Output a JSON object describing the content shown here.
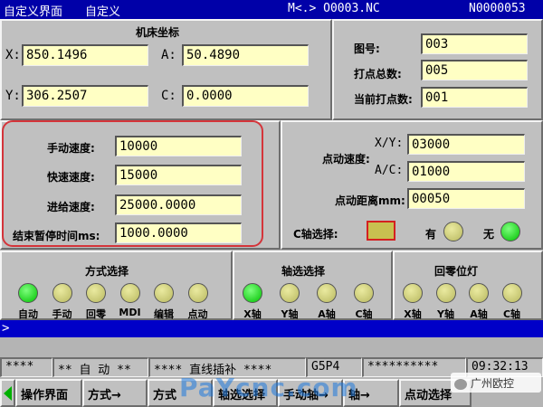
{
  "title_bar": {
    "screen_name": "自定义界面",
    "mode": "自定义",
    "program": "M<.> O0003.NC",
    "block": "N0000053"
  },
  "machine_coords": {
    "title": "机床坐标",
    "x_label": "X:",
    "x_value": "850.1496",
    "a_label": "A:",
    "a_value": "50.4890",
    "y_label": "Y:",
    "y_value": "306.2507",
    "c_label": "C:",
    "c_value": "0.0000"
  },
  "drawing_info": {
    "drawing_no_label": "图号:",
    "drawing_no_value": "003",
    "total_points_label": "打点总数:",
    "total_points_value": "005",
    "current_points_label": "当前打点数:",
    "current_points_value": "001"
  },
  "speeds": {
    "manual_label": "手动速度:",
    "manual_value": "10000",
    "rapid_label": "快速速度:",
    "rapid_value": "15000",
    "feed_label": "进给速度:",
    "feed_value": "25000.0000",
    "dwell_label": "结束暂停时间ms:",
    "dwell_value": "1000.0000"
  },
  "jog": {
    "xy_label": "X/Y:",
    "xy_value": "03000",
    "speed_label": "点动速度:",
    "ac_label": "A/C:",
    "ac_value": "01000",
    "distance_label": "点动距离mm:",
    "distance_value": "00050",
    "c_axis_label": "C轴选择:",
    "yes_label": "有",
    "no_label": "无",
    "indicator_color": "#c8c050"
  },
  "mode_select": {
    "title": "方式选择",
    "items": [
      {
        "label": "自动",
        "on": true
      },
      {
        "label": "手动",
        "on": false
      },
      {
        "label": "回零",
        "on": false
      },
      {
        "label": "MDI",
        "on": false
      },
      {
        "label": "编辑",
        "on": false
      },
      {
        "label": "点动",
        "on": false
      }
    ]
  },
  "axis_select": {
    "title": "轴选选择",
    "items": [
      {
        "label": "X轴",
        "on": true
      },
      {
        "label": "Y轴",
        "on": false
      },
      {
        "label": "A轴",
        "on": false
      },
      {
        "label": "C轴",
        "on": false
      }
    ]
  },
  "home_lamps": {
    "title": "回零位灯",
    "items": [
      {
        "label": "X轴",
        "on": false
      },
      {
        "label": "Y轴",
        "on": false
      },
      {
        "label": "A轴",
        "on": false
      },
      {
        "label": "C轴",
        "on": false
      }
    ]
  },
  "command_line": {
    "prompt": ">"
  },
  "status_bar": {
    "s1": "****",
    "s2": "** 自 动 **",
    "s3": "****  直线插补 ****",
    "s4": "G5P4",
    "s5": "**********",
    "time": "09:32:13"
  },
  "softkeys": {
    "k1": "操作界面",
    "k2": "方式→",
    "k3": "方式",
    "k4": "轴选选择",
    "k5": "手动轴→",
    "k6": "轴→",
    "k7": "点动选择"
  },
  "watermarks": {
    "brand": "PaYcnc.com",
    "wechat": "广州欧控"
  },
  "colors": {
    "lamp_on": "#00c000",
    "lamp_off": "#c8c870",
    "field_bg": "#ffffc4",
    "title_bg": "#0000a8",
    "highlight": "#d4343a"
  }
}
